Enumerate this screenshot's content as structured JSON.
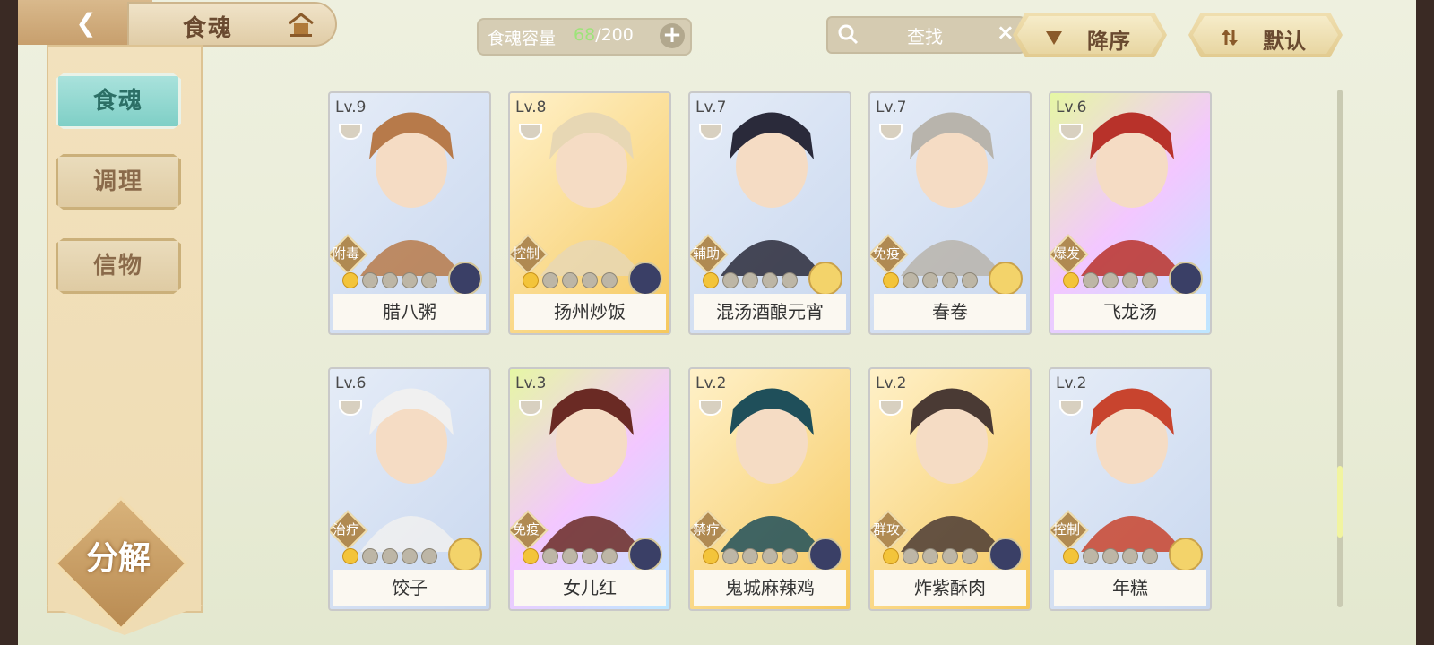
{
  "header": {
    "title": "食魂",
    "capacity_label": "食魂容量",
    "capacity_current": "68",
    "capacity_max": "/200",
    "capacity_add": "+",
    "search_placeholder": "查找",
    "search_clear": "×",
    "sort_order_label": "降序",
    "sort_mode_label": "默认"
  },
  "sidebar": {
    "items": [
      {
        "label": "食魂",
        "active": true
      },
      {
        "label": "调理",
        "active": false
      },
      {
        "label": "信物",
        "active": false
      }
    ],
    "decompose_label": "分解"
  },
  "cards": [
    {
      "level": "Lv.9",
      "role": "附毒",
      "name": "腊八粥",
      "rank": 1,
      "frame": "blue",
      "star": "blue"
    },
    {
      "level": "Lv.8",
      "role": "控制",
      "name": "扬州炒饭",
      "rank": 1,
      "frame": "gold",
      "star": "blue"
    },
    {
      "level": "Lv.7",
      "role": "辅助",
      "name": "混汤酒酿元宵",
      "rank": 1,
      "frame": "blue",
      "star": "gold"
    },
    {
      "level": "Lv.7",
      "role": "免疫",
      "name": "春卷",
      "rank": 1,
      "frame": "blue",
      "star": "gold"
    },
    {
      "level": "Lv.6",
      "role": "爆发",
      "name": "飞龙汤",
      "rank": 1,
      "frame": "rainbow",
      "star": "blue"
    },
    {
      "level": "Lv.6",
      "role": "治疗",
      "name": "饺子",
      "rank": 1,
      "frame": "blue",
      "star": "gold"
    },
    {
      "level": "Lv.3",
      "role": "免疫",
      "name": "女儿红",
      "rank": 1,
      "frame": "rainbow",
      "star": "blue"
    },
    {
      "level": "Lv.2",
      "role": "禁疗",
      "name": "鬼城麻辣鸡",
      "rank": 1,
      "frame": "gold",
      "star": "blue"
    },
    {
      "level": "Lv.2",
      "role": "群攻",
      "name": "炸紫酥肉",
      "rank": 1,
      "frame": "gold",
      "star": "blue"
    },
    {
      "level": "Lv.2",
      "role": "控制",
      "name": "年糕",
      "rank": 1,
      "frame": "blue",
      "star": "gold"
    }
  ],
  "colors": {
    "accent_teal": "#7fcfc6",
    "gold": "#f3c43a",
    "capacity_current": "#9ee37a"
  }
}
